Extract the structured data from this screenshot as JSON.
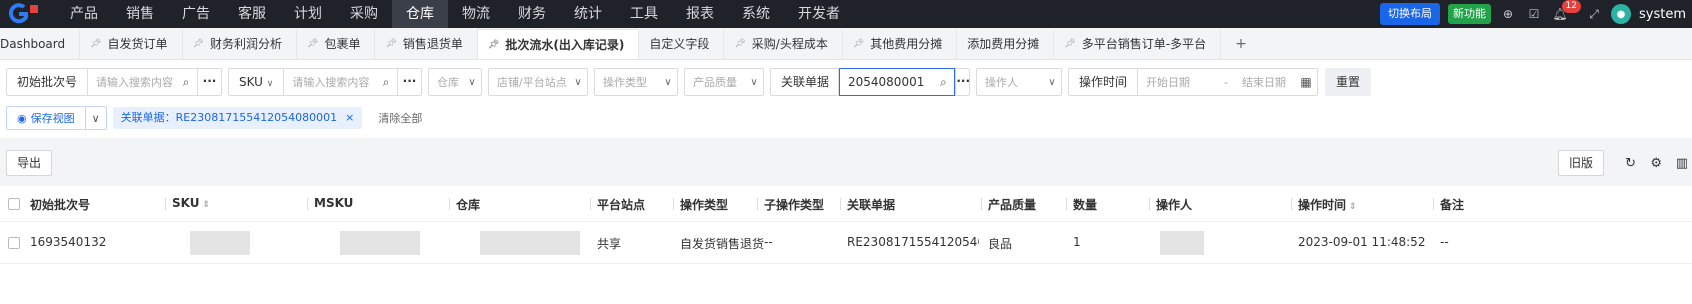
{
  "topnav": {
    "menu": [
      "产品",
      "销售",
      "广告",
      "客服",
      "计划",
      "采购",
      "仓库",
      "物流",
      "财务",
      "统计",
      "工具",
      "报表",
      "系统",
      "开发者"
    ],
    "active_index": 6,
    "switch_layout": "切换布局",
    "new_feature": "新功能",
    "notification_count": "12",
    "username": "system"
  },
  "tabs": [
    {
      "label": "Dashboard",
      "pinned": false
    },
    {
      "label": "自发货订单",
      "pinned": true
    },
    {
      "label": "财务利润分析",
      "pinned": true
    },
    {
      "label": "包裹单",
      "pinned": true
    },
    {
      "label": "销售退货单",
      "pinned": true
    },
    {
      "label": "批次流水(出入库记录)",
      "pinned": true,
      "active": true
    },
    {
      "label": "自定义字段",
      "pinned": false
    },
    {
      "label": "采购/头程成本",
      "pinned": true
    },
    {
      "label": "其他费用分摊",
      "pinned": true
    },
    {
      "label": "添加费用分摊",
      "pinned": false
    },
    {
      "label": "多平台销售订单-多平台",
      "pinned": true
    }
  ],
  "filters": {
    "initial_batch_label": "初始批次号",
    "initial_batch_placeholder": "请输入搜索内容",
    "sku_label": "SKU",
    "sku_placeholder": "请输入搜索内容",
    "warehouse": "仓库",
    "store_site": "店铺/平台站点",
    "op_type": "操作类型",
    "quality": "产品质量",
    "related_label": "关联单据",
    "related_value": "2054080001",
    "operator": "操作人",
    "op_time_label": "操作时间",
    "start_date": "开始日期",
    "date_sep": "-",
    "end_date": "结束日期",
    "reset": "重置"
  },
  "row2": {
    "save_view": "保存视图",
    "chip": "关联单据：RE230817155412054080001",
    "clear_all": "清除全部"
  },
  "toolbar": {
    "export": "导出",
    "old_version": "旧版"
  },
  "table": {
    "columns": [
      "初始批次号",
      "SKU",
      "MSKU",
      "仓库",
      "平台站点",
      "操作类型",
      "子操作类型",
      "关联单据",
      "产品质量",
      "数量",
      "操作人",
      "操作时间",
      "备注"
    ],
    "rows": [
      {
        "batch": "1693540132",
        "site": "共享",
        "op_type": "自发货销售退货",
        "sub_type": "--",
        "related": "RE2308171554120540...",
        "quality": "良品",
        "qty": "1",
        "time": "2023-09-01 11:48:52",
        "remark": "--"
      }
    ]
  }
}
